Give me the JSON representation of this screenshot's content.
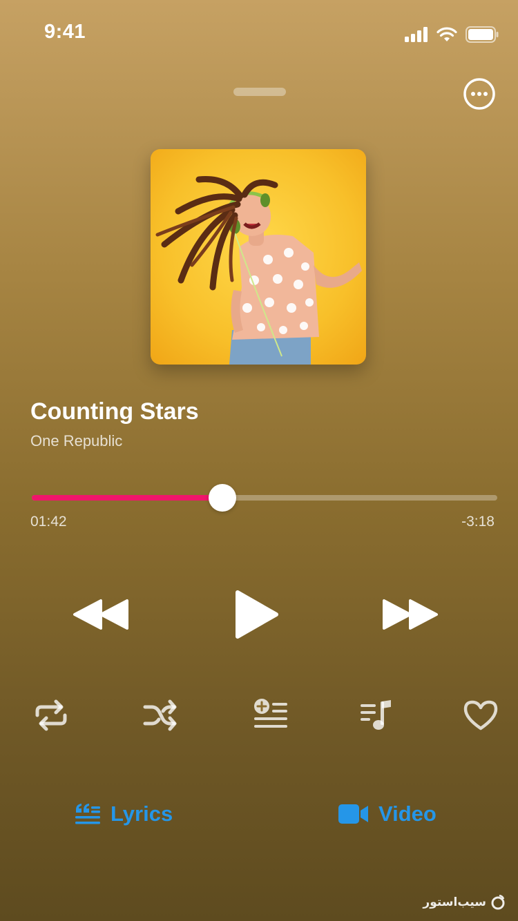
{
  "status_bar": {
    "time": "9:41",
    "icons": [
      "signal-icon",
      "wifi-icon",
      "battery-icon"
    ]
  },
  "header": {
    "more_icon": "ellipsis-circle-icon"
  },
  "track": {
    "title": "Counting Stars",
    "artist": "One Republic"
  },
  "progress": {
    "elapsed": "01:42",
    "remaining": "-3:18",
    "fraction": 0.409
  },
  "colors": {
    "accent": "#f0156b",
    "link": "#2596e8"
  },
  "actions": [
    "repeat-icon",
    "shuffle-icon",
    "queue-add-icon",
    "playlist-icon",
    "heart-icon"
  ],
  "bottom_links": {
    "lyrics": "Lyrics",
    "video": "Video"
  },
  "watermark": {
    "text": "سیب‌استور"
  }
}
